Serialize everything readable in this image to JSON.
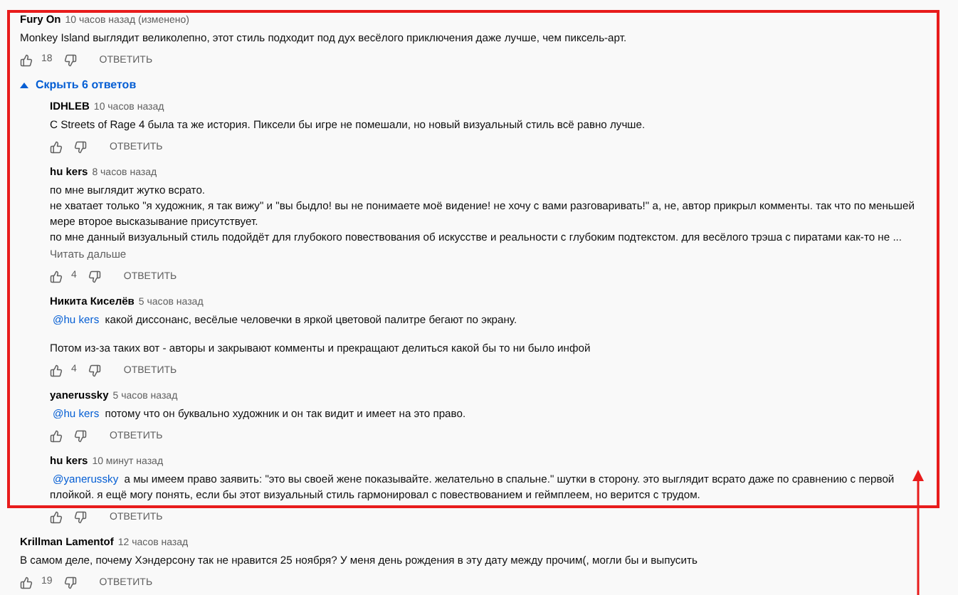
{
  "comments": [
    {
      "author": "Fury On",
      "time": "10 часов назад (изменено)",
      "paragraphs": [
        "Monkey Island выглядит великолепно, этот стиль подходит под дух весёлого приключения даже лучше, чем пиксель-арт."
      ],
      "likes": "18",
      "reply_label": "ОТВЕТИТЬ",
      "replies_toggle": {
        "label": "Скрыть 6 ответов",
        "expanded": true
      },
      "replies": [
        {
          "author": "IDHLEB",
          "time": "10 часов назад",
          "paragraphs": [
            "С Streets of Rage 4 была та же история. Пиксели бы игре не помешали, но новый визуальный стиль всё равно лучше."
          ],
          "reply_label": "ОТВЕТИТЬ"
        },
        {
          "author": "hu kers",
          "time": "8 часов назад",
          "paragraphs": [
            "по мне выглядит жутко всрато.",
            "не хватает только \"я художник, я так вижу\" и \"вы быдло! вы не понимаете моё видение! не хочу с вами разговаривать!\" а, не, автор прикрыл комменты. так что по меньшей мере второе высказывание присутствует.",
            "по мне данный визуальный стиль подойдёт для глубокого повествования об искусстве и реальности с глубоким подтекстом. для весёлого трэша с пиратами как-то не ..."
          ],
          "read_more": "Читать дальше",
          "likes": "4",
          "reply_label": "ОТВЕТИТЬ"
        },
        {
          "author": "Никита Киселёв",
          "time": "5 часов назад",
          "mention": "@hu kers",
          "paragraphs": [
            "какой диссонанс, весёлые человечки в яркой цветовой палитре бегают по экрану.",
            "Потом из-за таких вот - авторы и закрывают комменты и прекращают делиться какой бы то ни было инфой"
          ],
          "likes": "4",
          "reply_label": "ОТВЕТИТЬ"
        },
        {
          "author": "yanerussky",
          "time": "5 часов назад",
          "mention": "@hu kers",
          "paragraphs": [
            "потому что он буквально художник и он так видит и имеет на это право."
          ],
          "reply_label": "ОТВЕТИТЬ"
        },
        {
          "author": "hu kers",
          "time": "10 минут назад",
          "mention": "@yanerussky",
          "paragraphs": [
            "а мы имеем право заявить: \"это вы своей жене показывайте. желательно в спальне.\" шутки в сторону. это выглядит всрато даже по сравнению с первой плойкой. я ещё могу понять, если бы этот визуальный стиль гармонировал с повествованием и геймплеем, но верится с трудом."
          ],
          "reply_label": "ОТВЕТИТЬ"
        }
      ]
    },
    {
      "author": "Krillman Lamentof",
      "time": "12 часов назад",
      "paragraphs": [
        "В самом деле, почему Хэндерсону так не нравится 25 ноября? У меня день рождения в эту дату между прочим(, могли бы и выпусить"
      ],
      "likes": "19",
      "reply_label": "ОТВЕТИТЬ"
    }
  ]
}
